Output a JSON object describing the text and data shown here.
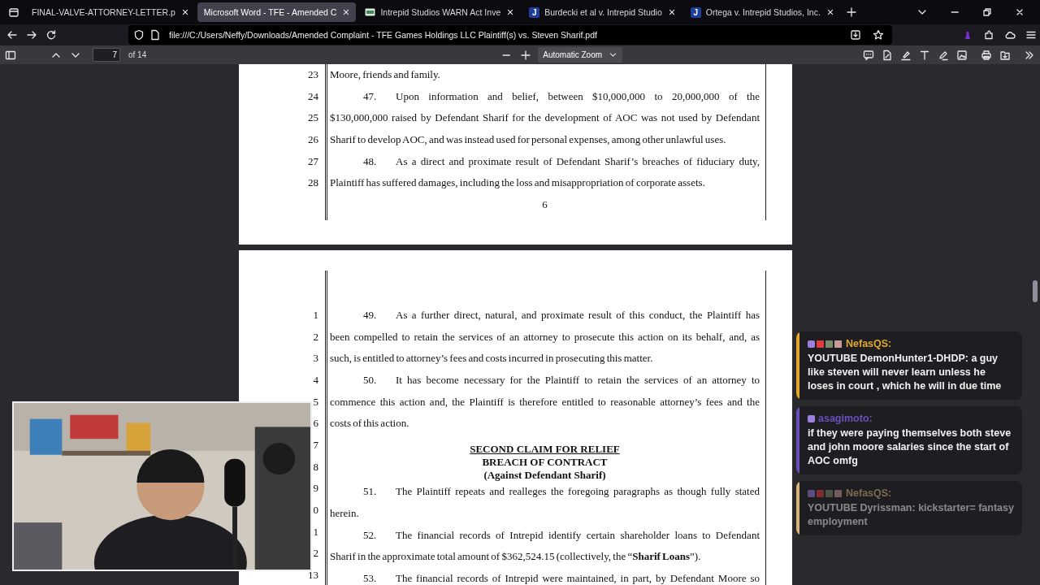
{
  "tabs": [
    {
      "title": "FINAL-VALVE-ATTORNEY-LETTER.p",
      "kind": "plain",
      "selected": false
    },
    {
      "title": "Microsoft Word - TFE - Amended C",
      "kind": "plain",
      "selected": true
    },
    {
      "title": "Intrepid Studios WARN Act Inve",
      "kind": "site",
      "selected": false
    },
    {
      "title": "Burdecki et al v. Intrepid Studio",
      "kind": "letter",
      "favicon": "J",
      "selected": false
    },
    {
      "title": "Ortega v. Intrepid Studios, Inc.",
      "kind": "letter",
      "favicon": "J",
      "selected": false
    }
  ],
  "address_bar": {
    "url": "file:///C:/Users/Neffy/Downloads/Amended Complaint - TFE Games Holdings LLC Plaintiff(s) vs. Steven Sharif.pdf"
  },
  "pdf_toolbar": {
    "page": "7",
    "page_count": "of 14",
    "zoom": "Automatic Zoom"
  },
  "pages": [
    {
      "line_numbers": [
        "23",
        "24",
        "25",
        "26",
        "27",
        "28"
      ],
      "page_number": "6",
      "blocks": [
        {
          "kind": "end",
          "text": "Moore, friends and family."
        },
        {
          "kind": "para",
          "num": "47.",
          "text": "Upon information and belief, between $10,000,000 to 20,000,000 of the"
        },
        {
          "kind": "line",
          "text": "$130,000,000 raised by Defendant Sharif for the development of AOC was not used by Defendant"
        },
        {
          "kind": "end",
          "text": "Sharif to develop AOC, and was instead used for personal expenses, among other unlawful uses."
        },
        {
          "kind": "para",
          "num": "48.",
          "text": "As a direct and proximate result of Defendant Sharif’s breaches of fiduciary duty,"
        },
        {
          "kind": "end",
          "text": "Plaintiff has suffered damages, including the loss and misappropriation of corporate assets."
        }
      ]
    },
    {
      "line_numbers": [
        "1",
        "2",
        "3",
        "4",
        "5",
        "6",
        "7",
        "8",
        "9",
        "0",
        "1",
        "2",
        "13"
      ],
      "blocks": [
        {
          "kind": "para",
          "num": "49.",
          "text": "As a further direct, natural, and proximate result of this conduct, the Plaintiff has"
        },
        {
          "kind": "line",
          "text": "been compelled to retain the services of an attorney to prosecute this action on its behalf, and, as"
        },
        {
          "kind": "end",
          "text": "such, is entitled to attorney’s fees and costs incurred in prosecuting this matter."
        },
        {
          "kind": "para",
          "num": "50.",
          "text": "It has become necessary for the Plaintiff to retain the services of an attorney to"
        },
        {
          "kind": "line",
          "text": "commence this action and, the Plaintiff is therefore entitled to reasonable attorney’s fees and the"
        },
        {
          "kind": "end",
          "text": "costs of this action."
        },
        {
          "kind": "heading",
          "lines": [
            {
              "text": "SECOND CLAIM FOR RELIEF",
              "underlined": true
            },
            {
              "text": "BREACH OF CONTRACT",
              "underlined": false
            },
            {
              "text": "(Against Defendant Sharif)",
              "underlined": false
            }
          ]
        },
        {
          "kind": "para",
          "num": "51.",
          "text": "The Plaintiff repeats and realleges the foregoing paragraphs as though fully stated"
        },
        {
          "kind": "end",
          "text": "herein."
        },
        {
          "kind": "para",
          "num": "52.",
          "text": "The financial records of Intrepid identify certain shareholder loans to Defendant"
        },
        {
          "kind": "end",
          "text": "Sharif in the approximate total amount of $362,524.15 (collectively, the “**Sharif Loans**”)."
        },
        {
          "kind": "para",
          "num": "53.",
          "text": "The financial records of Intrepid were maintained, in part, by Defendant Moore so"
        }
      ]
    }
  ],
  "chat": [
    {
      "kind": "relay",
      "user": "NefasQS:",
      "color": "#e0a82e",
      "faded": false,
      "text": "YOUTUBE DemonHunter1-DHDP: a guy like steven will never learn unless he loses in court , which he will in due time"
    },
    {
      "kind": "direct",
      "user": "asagimoto:",
      "color": "#6b4fbb",
      "faded": false,
      "text": "if they were paying themselves both steve and john moore salaries since the start of AOC omfg"
    },
    {
      "kind": "relay",
      "user": "NefasQS:",
      "color": "#d9b47a",
      "faded": true,
      "text": "YOUTUBE Dyrissman: kickstarter= fantasy employment"
    }
  ]
}
